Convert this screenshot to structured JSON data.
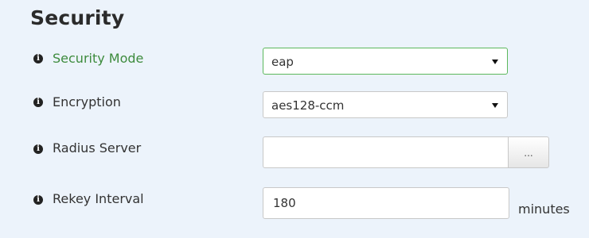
{
  "section": {
    "title": "Security"
  },
  "fields": {
    "security_mode": {
      "label": "Security Mode",
      "value": "eap"
    },
    "encryption": {
      "label": "Encryption",
      "value": "aes128-ccm"
    },
    "radius_server": {
      "label": "Radius Server",
      "value": "",
      "placeholder": "",
      "browse_label": "..."
    },
    "rekey_interval": {
      "label": "Rekey Interval",
      "value": "180",
      "unit": "minutes"
    }
  },
  "icons": {
    "info": "info-circle-icon",
    "dropdown": "caret-down-icon"
  },
  "colors": {
    "background": "#ecf3fb",
    "active_label": "#3d8b3d",
    "focus_border": "#5cb85c"
  }
}
